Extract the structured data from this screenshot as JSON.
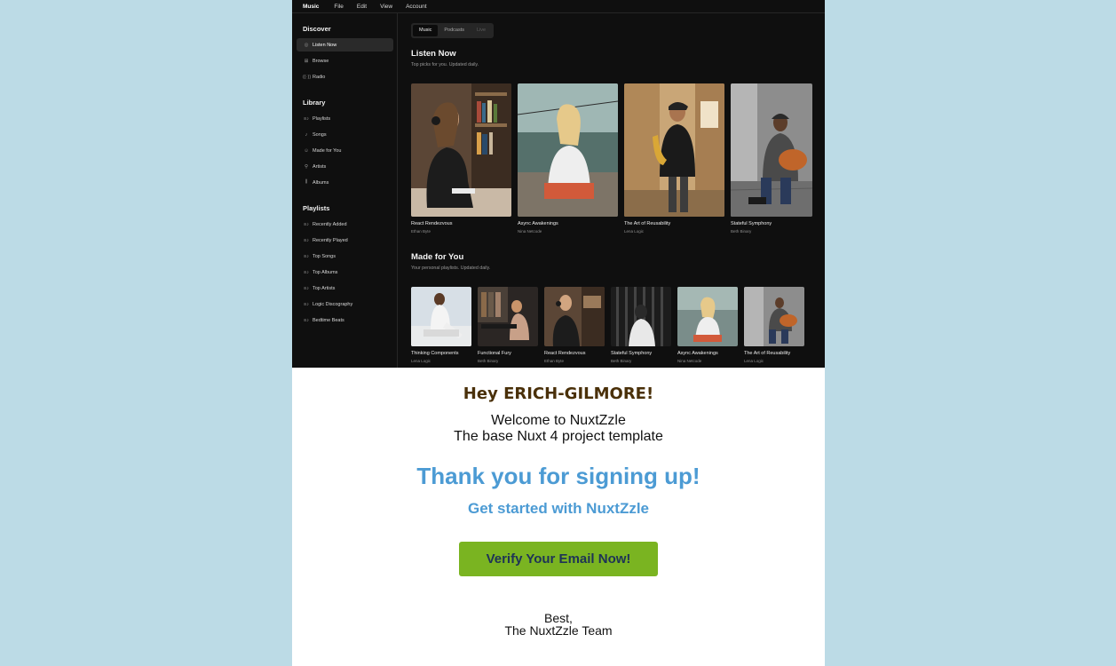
{
  "menubar": [
    "Music",
    "File",
    "Edit",
    "View",
    "Account"
  ],
  "sidebar": {
    "discover_title": "Discover",
    "discover": [
      {
        "label": "Listen Now",
        "icon": "play-circle-icon",
        "glyph": "◎"
      },
      {
        "label": "Browse",
        "icon": "grid-icon",
        "glyph": "⊞"
      },
      {
        "label": "Radio",
        "icon": "radio-icon",
        "glyph": "((·))"
      }
    ],
    "library_title": "Library",
    "library": [
      {
        "label": "Playlists",
        "icon": "playlist-icon",
        "glyph": "≡♪"
      },
      {
        "label": "Songs",
        "icon": "music-note-icon",
        "glyph": "♪"
      },
      {
        "label": "Made for You",
        "icon": "user-icon",
        "glyph": "☺"
      },
      {
        "label": "Artists",
        "icon": "mic-icon",
        "glyph": "⚲"
      },
      {
        "label": "Albums",
        "icon": "library-icon",
        "glyph": "⫼"
      }
    ],
    "playlists_title": "Playlists",
    "playlists": [
      {
        "label": "Recently Added",
        "icon": "playlist-icon",
        "glyph": "≡♪"
      },
      {
        "label": "Recently Played",
        "icon": "playlist-icon",
        "glyph": "≡♪"
      },
      {
        "label": "Top Songs",
        "icon": "playlist-icon",
        "glyph": "≡♪"
      },
      {
        "label": "Top Albums",
        "icon": "playlist-icon",
        "glyph": "≡♪"
      },
      {
        "label": "Top Artists",
        "icon": "playlist-icon",
        "glyph": "≡♪"
      },
      {
        "label": "Logic Discography",
        "icon": "playlist-icon",
        "glyph": "≡♪"
      },
      {
        "label": "Bedtime Beats",
        "icon": "playlist-icon",
        "glyph": "≡♪"
      }
    ]
  },
  "main": {
    "tabs": [
      "Music",
      "Podcasts",
      "Live"
    ],
    "listen_now_title": "Listen Now",
    "listen_now_sub": "Top picks for you. Updated daily.",
    "listen_now": [
      {
        "title": "React Rendezvous",
        "artist": "Ethan Byte"
      },
      {
        "title": "Async Awakenings",
        "artist": "Nina Netcode"
      },
      {
        "title": "The Art of Reusability",
        "artist": "Lena Logic"
      },
      {
        "title": "Stateful Symphony",
        "artist": "Beth Binary"
      }
    ],
    "made_for_you_title": "Made for You",
    "made_for_you_sub": "Your personal playlists. Updated daily.",
    "made_for_you": [
      {
        "title": "Thinking Components",
        "artist": "Lena Logic"
      },
      {
        "title": "Functional Fury",
        "artist": "Beth Binary"
      },
      {
        "title": "React Rendezvous",
        "artist": "Ethan Byte"
      },
      {
        "title": "Stateful Symphony",
        "artist": "Beth Binary"
      },
      {
        "title": "Async Awakenings",
        "artist": "Nina Netcode"
      },
      {
        "title": "The Art of Reusability",
        "artist": "Lena Logic"
      }
    ]
  },
  "email": {
    "greeting": "Hey ERICH-GILMORE!",
    "welcome_line1": "Welcome to NuxtZzle",
    "welcome_line2": "The base Nuxt 4 project template",
    "thanks": "Thank you for signing up!",
    "get_started": "Get started with NuxtZzle",
    "verify_button": "Verify Your Email Now!",
    "sign_line1": "Best,",
    "sign_line2": "The NuxtZzle Team"
  },
  "colors": {
    "page_bg": "#bcdbe6",
    "app_bg": "#0f0f0f",
    "greeting": "#4a3009",
    "accent_blue": "#4c9bd4",
    "button_green": "#7ab421",
    "button_text": "#1e3356"
  }
}
